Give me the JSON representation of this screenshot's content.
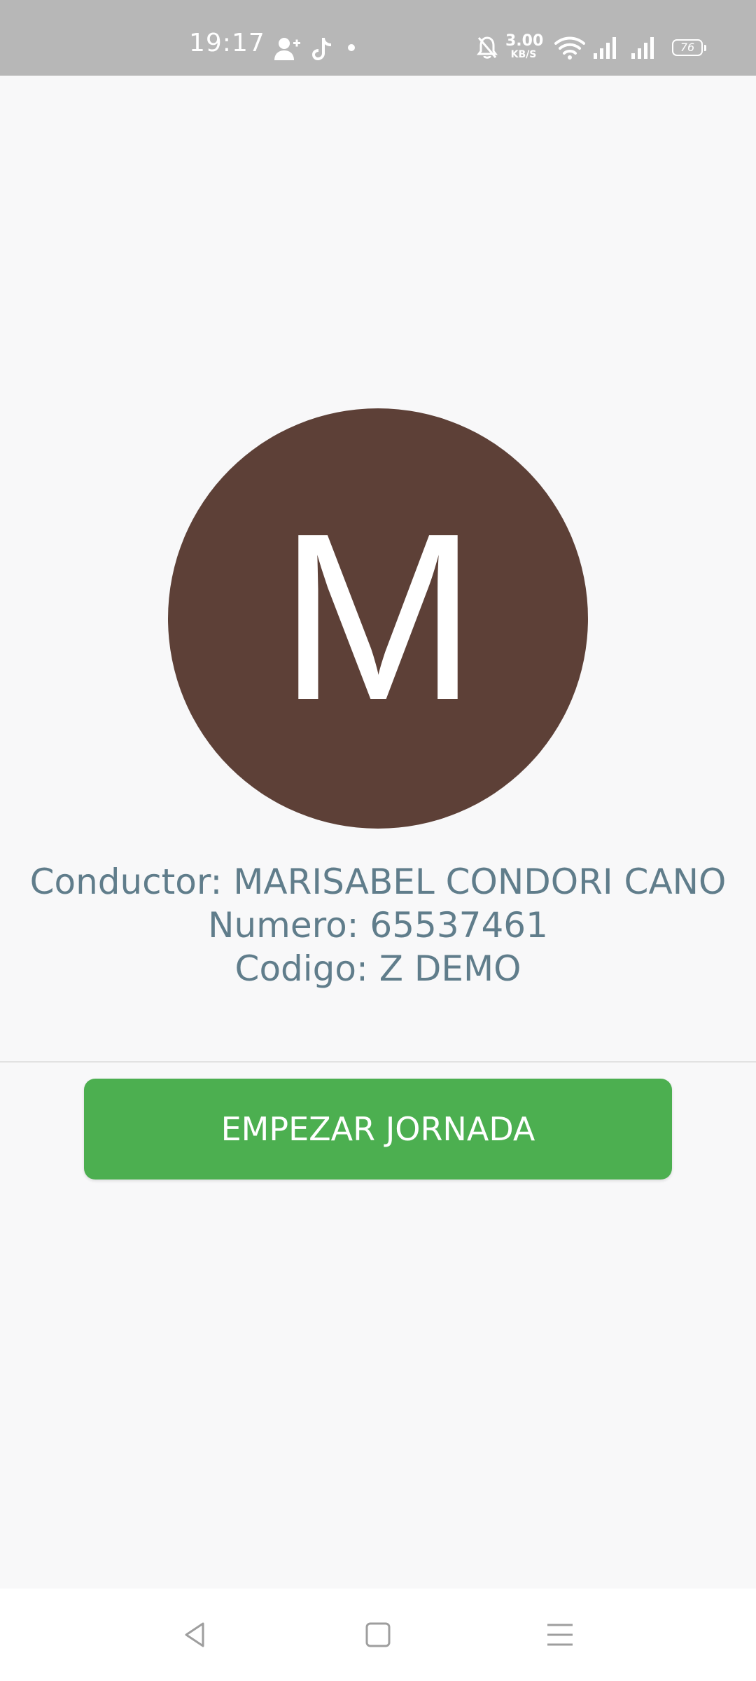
{
  "status_bar": {
    "time": "19:17",
    "net_speed_value": "3.00",
    "net_speed_unit": "KB/S",
    "battery_level": "76",
    "icons": [
      "add-contact-icon",
      "tiktok-icon",
      "notification-dot-icon",
      "bell-off-icon",
      "wifi-icon",
      "signal-icon",
      "signal-icon",
      "battery-icon"
    ]
  },
  "avatar": {
    "letter": "M",
    "color": "#5d4037"
  },
  "driver": {
    "name_line": "Conductor: MARISABEL CONDORI CANO",
    "number_line": "Numero: 65537461",
    "code_line": "Codigo: Z DEMO",
    "text_color": "#607d8b"
  },
  "actions": {
    "start_label": "EMPEZAR JORNADA",
    "start_color": "#4caf50"
  },
  "nav": {
    "buttons": [
      "back-icon",
      "home-icon",
      "menu-icon"
    ]
  }
}
